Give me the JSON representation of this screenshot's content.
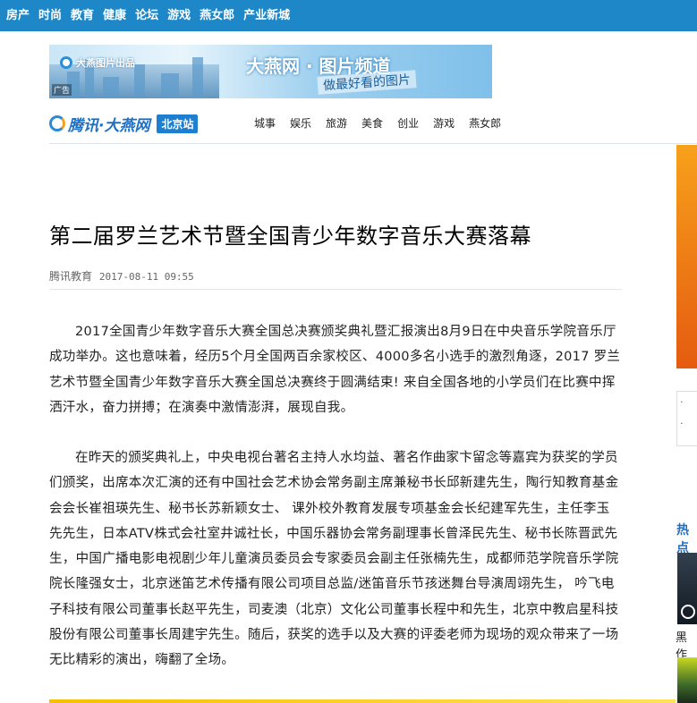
{
  "topnav": {
    "items": [
      "房产",
      "时尚",
      "教育",
      "健康",
      "论坛",
      "游戏",
      "燕女郎",
      "产业新城"
    ]
  },
  "banner": {
    "source_label": "大燕图片出品",
    "ad_tag": "广告",
    "title": "大燕网 · 图片频道",
    "slogan": "做最好看的图片"
  },
  "brand": {
    "logo_text": "腾讯·大燕网",
    "station": "北京站",
    "channels": [
      "城事",
      "娱乐",
      "旅游",
      "美食",
      "创业",
      "游戏",
      "燕女郎"
    ]
  },
  "sidebar": {
    "box_items": [
      "·",
      "·"
    ],
    "hot_label": "热点",
    "thumb_caption": "黑作"
  },
  "article": {
    "title": "第二届罗兰艺术节暨全国青少年数字音乐大赛落幕",
    "source": "腾讯教育",
    "date": "2017-08-11 09:55",
    "paragraphs": [
      "2017全国青少年数字音乐大赛全国总决赛颁奖典礼暨汇报演出8月9日在中央音乐学院音乐厅成功举办。这也意味着，经历5个月全国两百余家校区、4000多名小选手的激烈角逐，2017 罗兰艺术节暨全国青少年数字音乐大赛全国总决赛终于圆满结束! 来自全国各地的小学员们在比赛中挥洒汗水，奋力拼搏；在演奏中激情澎湃，展现自我。",
      "在昨天的颁奖典礼上，中央电视台著名主持人水均益、著名作曲家卞留念等嘉宾为获奖的学员们颁奖，出席本次汇演的还有中国社会艺术协会常务副主席兼秘书长邱新建先生，陶行知教育基金会会长崔祖瑛先生、秘书长苏新颖女士、 课外校外教育发展专项基金会长纪建军先生，主任李玉先先生，日本ATV株式会社室井诚社长，中国乐器协会常务副理事长曾泽民先生、秘书长陈晋武先生，中国广播电影电视剧少年儿童演员委员会专家委员会副主任张楠先生，成都师范学院音乐学院院长隆强女士，北京迷笛艺术传播有限公司项目总监/迷笛音乐节孩迷舞台导演周翊先生， 吟飞电子科技有限公司董事长赵平先生，司麦澳（北京）文化公司董事长程中和先生，北京中教启星科技股份有限公司董事长周建宇先生。随后，获奖的选手以及大赛的评委老师为现场的观众带来了一场无比精彩的演出，嗨翻了全场。"
    ]
  },
  "colors": {
    "topnav_bg": "#1d87c8",
    "brand_blue": "#1e6fc4",
    "accent_orange": "#f3a21b"
  }
}
